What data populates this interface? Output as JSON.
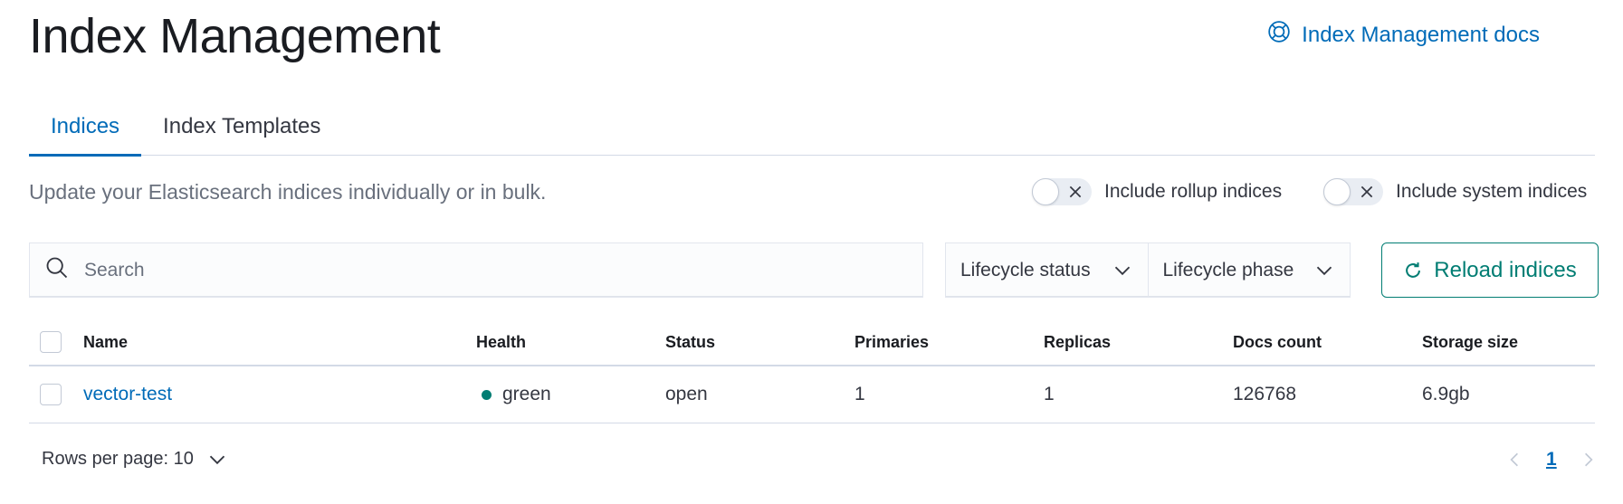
{
  "header": {
    "title": "Index Management",
    "docs_link": {
      "label": "Index Management docs",
      "icon": "help-lifebuoy-icon"
    }
  },
  "tabs": [
    {
      "label": "Indices",
      "active": true
    },
    {
      "label": "Index Templates",
      "active": false
    }
  ],
  "description": "Update your Elasticsearch indices individually or in bulk.",
  "toggles": {
    "rollup": {
      "label": "Include rollup indices",
      "checked": false
    },
    "system": {
      "label": "Include system indices",
      "checked": false
    }
  },
  "search": {
    "placeholder": "Search",
    "value": ""
  },
  "filters": {
    "lifecycle_status": "Lifecycle status",
    "lifecycle_phase": "Lifecycle phase"
  },
  "reload_button": "Reload indices",
  "table": {
    "columns": [
      "Name",
      "Health",
      "Status",
      "Primaries",
      "Replicas",
      "Docs count",
      "Storage size"
    ],
    "rows": [
      {
        "name": "vector-test",
        "health": "green",
        "status": "open",
        "primaries": "1",
        "replicas": "1",
        "docs_count": "126768",
        "storage_size": "6.9gb"
      }
    ]
  },
  "pagination": {
    "rows_per_page": "Rows per page: 10",
    "current_page": "1"
  },
  "colors": {
    "link": "#006bb8",
    "reload_accent": "#017d73",
    "health_green": "#017d73",
    "title": "#1a1c21",
    "description": "#69707d"
  }
}
